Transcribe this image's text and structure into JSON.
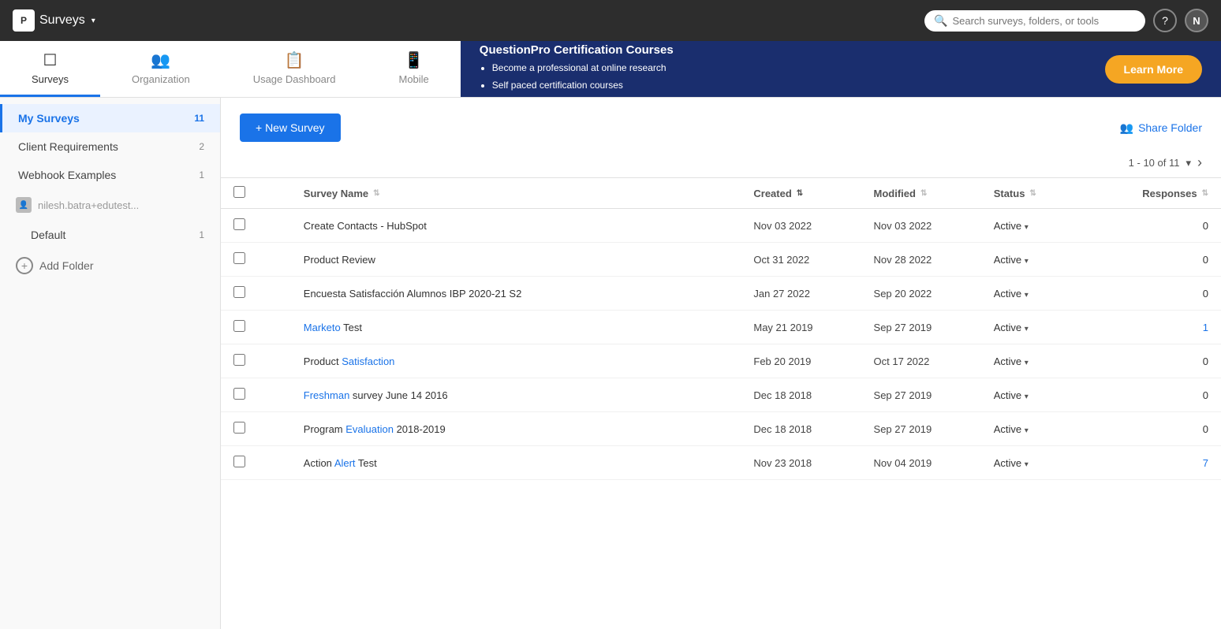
{
  "topNav": {
    "brand": "P",
    "title": "Surveys",
    "searchPlaceholder": "Search surveys, folders, or tools",
    "helpLabel": "?",
    "userInitial": "N",
    "dropdownArrow": "▾"
  },
  "tabs": [
    {
      "id": "surveys",
      "label": "Surveys",
      "icon": "☐",
      "active": true
    },
    {
      "id": "organization",
      "label": "Organization",
      "icon": "👥",
      "active": false
    },
    {
      "id": "usage-dashboard",
      "label": "Usage Dashboard",
      "icon": "📋",
      "active": false
    },
    {
      "id": "mobile",
      "label": "Mobile",
      "icon": "📱",
      "active": false
    }
  ],
  "promo": {
    "title": "QuestionPro Certification Courses",
    "bullets": [
      "Become a professional at online research",
      "Self paced certification courses"
    ],
    "learnMoreLabel": "Learn More"
  },
  "sidebar": {
    "items": [
      {
        "id": "my-surveys",
        "label": "My Surveys",
        "count": "11",
        "active": true
      },
      {
        "id": "client-requirements",
        "label": "Client Requirements",
        "count": "2",
        "active": false
      },
      {
        "id": "webhook-examples",
        "label": "Webhook Examples",
        "count": "1",
        "active": false
      }
    ],
    "userFolder": {
      "icon": "👤",
      "label": "nilesh.batra+edutest..."
    },
    "defaultFolder": {
      "label": "Default",
      "count": "1"
    },
    "addFolderLabel": "Add Folder"
  },
  "content": {
    "newSurveyLabel": "+ New Survey",
    "shareFolderLabel": "Share Folder",
    "pagination": {
      "text": "1 - 10 of 11",
      "nextArrow": "›"
    },
    "table": {
      "columns": [
        {
          "id": "survey-name",
          "label": "Survey Name",
          "sortable": true
        },
        {
          "id": "created",
          "label": "Created",
          "sortable": true
        },
        {
          "id": "modified",
          "label": "Modified",
          "sortable": true
        },
        {
          "id": "status",
          "label": "Status",
          "sortable": true
        },
        {
          "id": "responses",
          "label": "Responses",
          "sortable": true
        }
      ],
      "rows": [
        {
          "name": "Create Contacts - HubSpot",
          "nameParts": [
            "Create ",
            "Contacts",
            " - HubSpot"
          ],
          "nameHighlight": [
            false,
            false,
            false
          ],
          "created": "Nov 03 2022",
          "modified": "Nov 03 2022",
          "status": "Active",
          "responses": "0",
          "responseIsLink": false
        },
        {
          "name": "Product Review",
          "nameParts": [
            "Product ",
            "Review"
          ],
          "nameHighlight": [
            false,
            false
          ],
          "created": "Oct 31 2022",
          "modified": "Nov 28 2022",
          "status": "Active",
          "responses": "0",
          "responseIsLink": false
        },
        {
          "name": "Encuesta Satisfacción Alumnos IBP 2020-21 S2",
          "nameParts": [
            "Encuesta Satisfacción Alumnos IBP 2020-21 S2"
          ],
          "nameHighlight": [
            false
          ],
          "created": "Jan 27 2022",
          "modified": "Sep 20 2022",
          "status": "Active",
          "responses": "0",
          "responseIsLink": false
        },
        {
          "name": "Marketo Test",
          "nameParts": [
            "Marketo ",
            "Test"
          ],
          "nameHighlight": [
            true,
            false
          ],
          "created": "May 21 2019",
          "modified": "Sep 27 2019",
          "status": "Active",
          "responses": "1",
          "responseIsLink": true
        },
        {
          "name": "Product Satisfaction",
          "nameParts": [
            "Product ",
            "Satisfaction"
          ],
          "nameHighlight": [
            false,
            true
          ],
          "created": "Feb 20 2019",
          "modified": "Oct 17 2022",
          "status": "Active",
          "responses": "0",
          "responseIsLink": false
        },
        {
          "name": "Freshman survey June 14 2016",
          "nameParts": [
            "Freshman ",
            "survey June 14 2016"
          ],
          "nameHighlight": [
            true,
            false
          ],
          "created": "Dec 18 2018",
          "modified": "Sep 27 2019",
          "status": "Active",
          "responses": "0",
          "responseIsLink": false
        },
        {
          "name": "Program Evaluation 2018-2019",
          "nameParts": [
            "Program ",
            "Evaluation",
            " 2018-2019"
          ],
          "nameHighlight": [
            false,
            true,
            false
          ],
          "created": "Dec 18 2018",
          "modified": "Sep 27 2019",
          "status": "Active",
          "responses": "0",
          "responseIsLink": false
        },
        {
          "name": "Action Alert Test",
          "nameParts": [
            "Action ",
            "Alert",
            " Test"
          ],
          "nameHighlight": [
            false,
            true,
            false
          ],
          "created": "Nov 23 2018",
          "modified": "Nov 04 2019",
          "status": "Active",
          "responses": "7",
          "responseIsLink": true
        }
      ]
    }
  },
  "colors": {
    "brand": "#1a73e8",
    "navBg": "#2d2d2d",
    "promoBg": "#1a2e6e",
    "learnMore": "#f5a623",
    "activeTab": "#1a73e8"
  }
}
